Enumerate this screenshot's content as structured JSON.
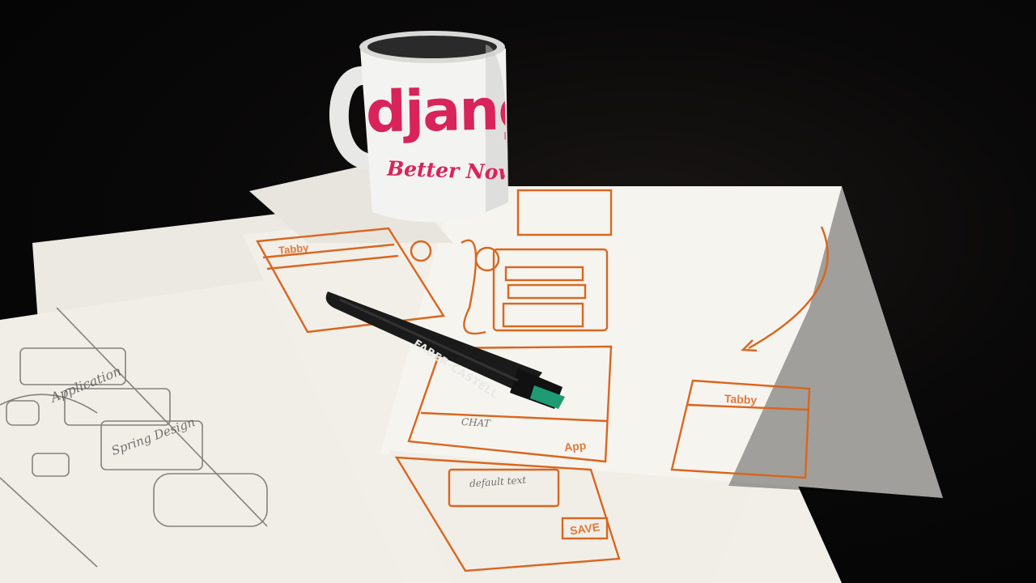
{
  "scene": {
    "description_kind": "photo",
    "mug": {
      "logo_text": "django",
      "slogan_text": "Better Now Th",
      "print_color": "#d8245a"
    },
    "pen": {
      "brand_text": "FABER-CASTELL",
      "cap_color": "#1f9b74"
    },
    "sketch_labels": {
      "save": "SAVE",
      "default_text": "default text",
      "tabby": "Tabby",
      "app": "App",
      "chat": "CHAT",
      "wireframe_text": "Application",
      "spring_design": "Spring Design"
    },
    "colors": {
      "paper": "#f3f1ec",
      "orange_ink": "#d9661f",
      "pencil": "#5b5a58",
      "background": "#050505"
    }
  }
}
